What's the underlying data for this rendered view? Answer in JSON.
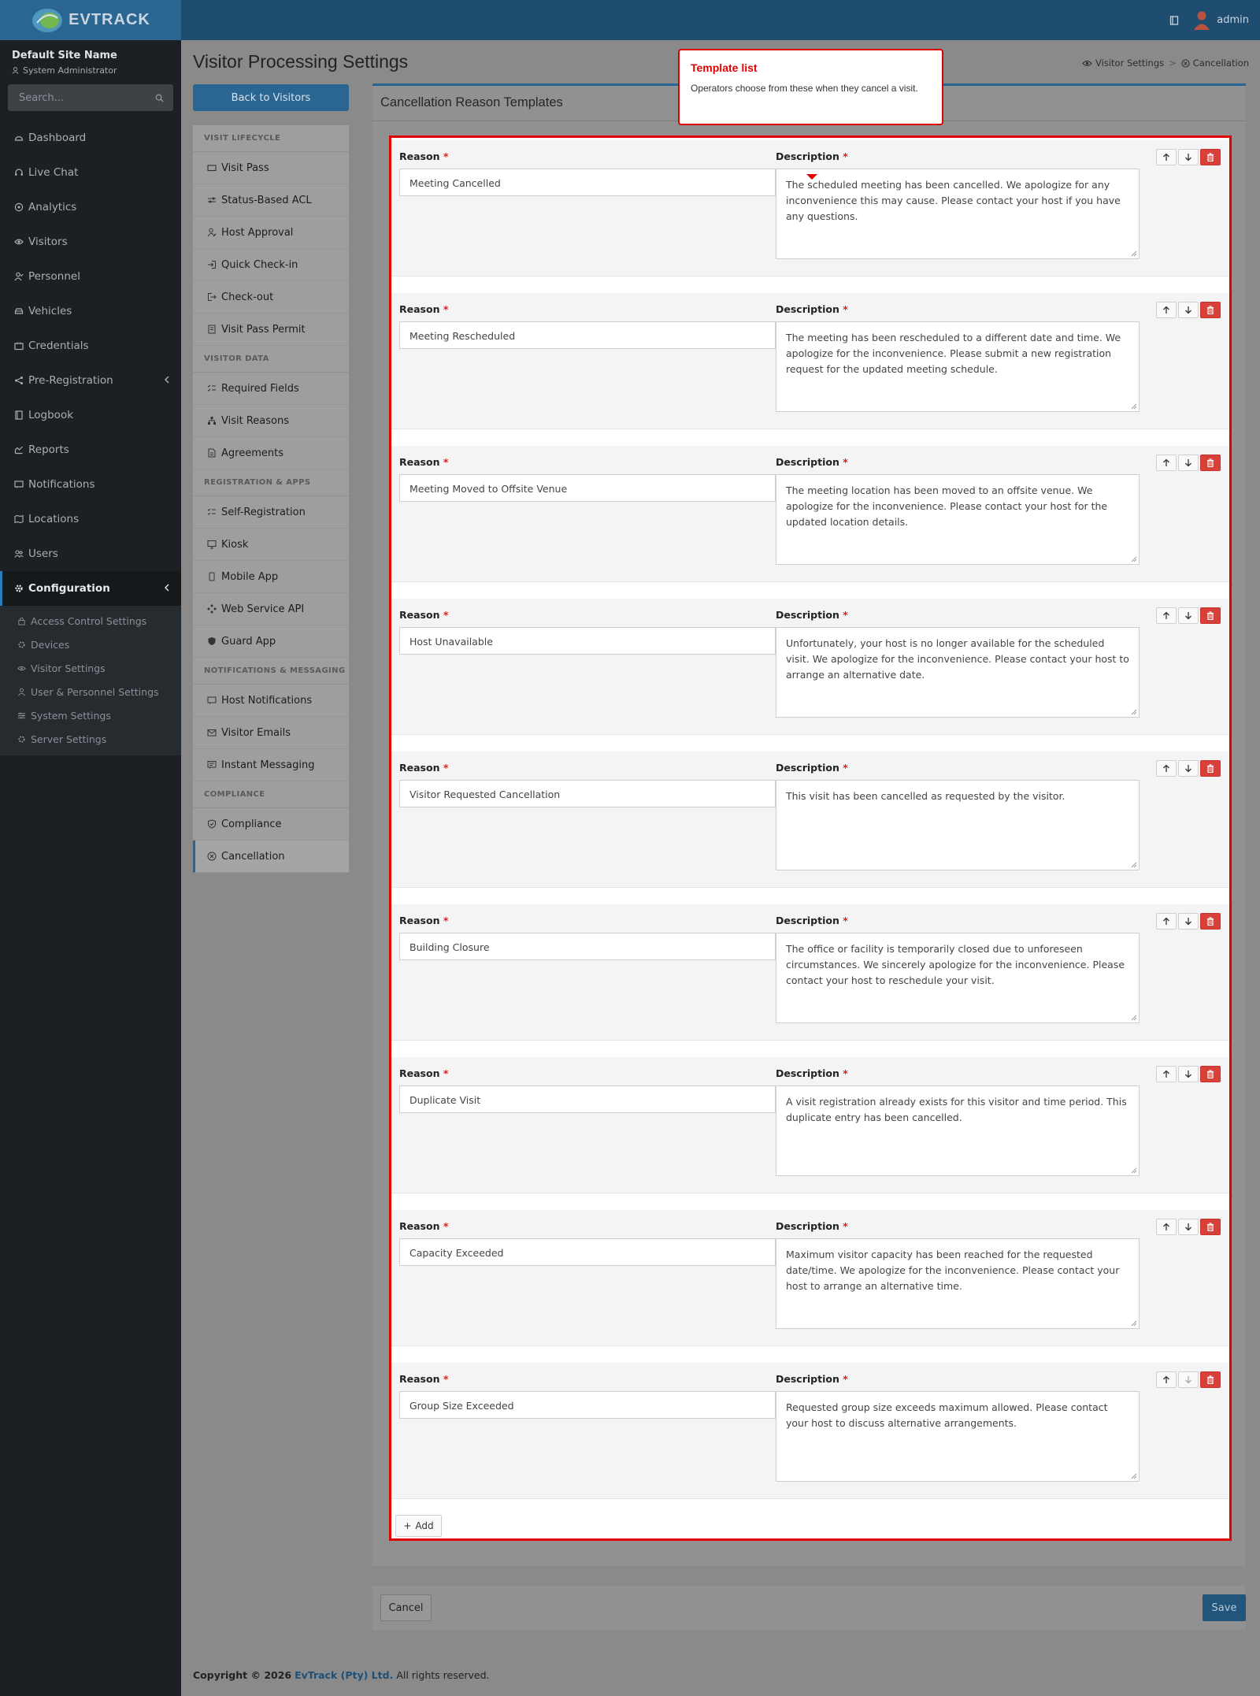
{
  "topbar": {
    "brand": "EVTRACK",
    "user": "admin"
  },
  "sidebar": {
    "site_name": "Default Site Name",
    "role": "System Administrator",
    "search_placeholder": "Search...",
    "items": [
      {
        "label": "Dashboard",
        "icon": "dashboard-icon"
      },
      {
        "label": "Live Chat",
        "icon": "headset-icon"
      },
      {
        "label": "Analytics",
        "icon": "analytics-icon"
      },
      {
        "label": "Visitors",
        "icon": "eye-icon"
      },
      {
        "label": "Personnel",
        "icon": "user-check-icon"
      },
      {
        "label": "Vehicles",
        "icon": "car-icon"
      },
      {
        "label": "Credentials",
        "icon": "id-card-icon"
      },
      {
        "label": "Pre-Registration",
        "icon": "share-icon"
      },
      {
        "label": "Logbook",
        "icon": "book-icon"
      },
      {
        "label": "Reports",
        "icon": "chart-icon"
      },
      {
        "label": "Notifications",
        "icon": "message-icon"
      },
      {
        "label": "Locations",
        "icon": "map-icon"
      },
      {
        "label": "Users",
        "icon": "users-icon"
      },
      {
        "label": "Configuration",
        "icon": "settings-icon"
      }
    ],
    "config_sub": [
      {
        "label": "Access Control Settings"
      },
      {
        "label": "Devices"
      },
      {
        "label": "Visitor Settings"
      },
      {
        "label": "User & Personnel Settings"
      },
      {
        "label": "System Settings"
      },
      {
        "label": "Server Settings"
      }
    ]
  },
  "page": {
    "title": "Visitor Processing Settings",
    "breadcrumb": [
      "Visitor Settings",
      "Cancellation"
    ],
    "back_button": "Back to Visitors"
  },
  "subnav": {
    "groups": [
      "VISIT LIFECYCLE",
      "VISITOR DATA",
      "REGISTRATION & APPS",
      "NOTIFICATIONS & MESSAGING",
      "COMPLIANCE"
    ],
    "items": [
      "Visit Pass",
      "Status-Based ACL",
      "Host Approval",
      "Quick Check-in",
      "Check-out",
      "Visit Pass Permit",
      "Required Fields",
      "Visit Reasons",
      "Agreements",
      "Self-Registration",
      "Kiosk",
      "Mobile App",
      "Web Service API",
      "Guard App",
      "Host Notifications",
      "Visitor Emails",
      "Instant Messaging",
      "Compliance",
      "Cancellation"
    ]
  },
  "card": {
    "title": "Cancellation Reason Templates",
    "reason_label": "Reason",
    "description_label": "Description",
    "required_mark": "*",
    "add_label": "Add",
    "templates": [
      {
        "reason": "Meeting Cancelled",
        "description": "The scheduled meeting has been cancelled. We apologize for any inconvenience this may cause. Please contact your host if you have any questions."
      },
      {
        "reason": "Meeting Rescheduled",
        "description": "The meeting has been rescheduled to a different date and time. We apologize for the inconvenience. Please submit a new registration request for the updated meeting schedule."
      },
      {
        "reason": "Meeting Moved to Offsite Venue",
        "description": "The meeting location has been moved to an offsite venue. We apologize for the inconvenience. Please contact your host for the updated location details."
      },
      {
        "reason": "Host Unavailable",
        "description": "Unfortunately, your host is no longer available for the scheduled visit. We apologize for the inconvenience. Please contact your host to arrange an alternative date."
      },
      {
        "reason": "Visitor Requested Cancellation",
        "description": "This visit has been cancelled as requested by the visitor."
      },
      {
        "reason": "Building Closure",
        "description": "The office or facility is temporarily closed due to unforeseen circumstances. We sincerely apologize for the inconvenience. Please contact your host to reschedule your visit."
      },
      {
        "reason": "Duplicate Visit",
        "description": "A visit registration already exists for this visitor and time period. This duplicate entry has been cancelled."
      },
      {
        "reason": "Capacity Exceeded",
        "description": "Maximum visitor capacity has been reached for the requested date/time. We apologize for the inconvenience. Please contact your host to arrange an alternative time."
      },
      {
        "reason": "Group Size Exceeded",
        "description": "Requested group size exceeds maximum allowed. Please contact your host to discuss alternative arrangements."
      }
    ]
  },
  "actions": {
    "cancel": "Cancel",
    "save": "Save"
  },
  "footer": {
    "prefix": "Copyright © 2026",
    "company": "EvTrack (Pty) Ltd.",
    "suffix": "All rights reserved."
  },
  "tooltip": {
    "title": "Template list",
    "body": "Operators choose from these when they cancel a visit."
  },
  "colors": {
    "accent": "#2b6592",
    "highlight": "#e00000",
    "delete": "#d8413a"
  }
}
